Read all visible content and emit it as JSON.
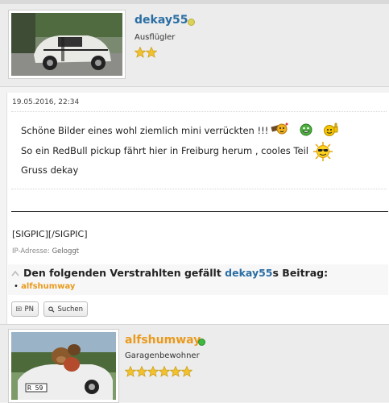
{
  "post1": {
    "username": "dekay55",
    "usertitle": "Ausflügler",
    "stars": 2,
    "date": "19.05.2016, 22:34",
    "lines": [
      "Schöne Bilder eines wohl ziemlich mini verrückten !!!",
      "So ein RedBull pickup fährt hier in Freiburg herum , cooles Teil",
      "Gruss dekay"
    ],
    "signature": "[SIGPIC][/SIGPIC]",
    "ip_label": "IP-Adresse:",
    "ip_value": "Geloggt",
    "likes_prefix": "Den folgenden Verstrahlten gefällt",
    "likes_user": "dekay55",
    "likes_suffix": "s Beitrag:",
    "liked_by": "alfshumway",
    "buttons": {
      "pm": "PN",
      "search": "Suchen"
    }
  },
  "post2": {
    "username": "alfshumway",
    "usertitle": "Garagenbewohner",
    "stars": 6,
    "plate_text": "R 59"
  },
  "colors": {
    "username_blue": "#2b6ea3",
    "username_orange": "#e99a1d",
    "away_dot": "#dcd25a",
    "online_dot": "#3fb83f",
    "star_gold": "#f2c12e"
  }
}
